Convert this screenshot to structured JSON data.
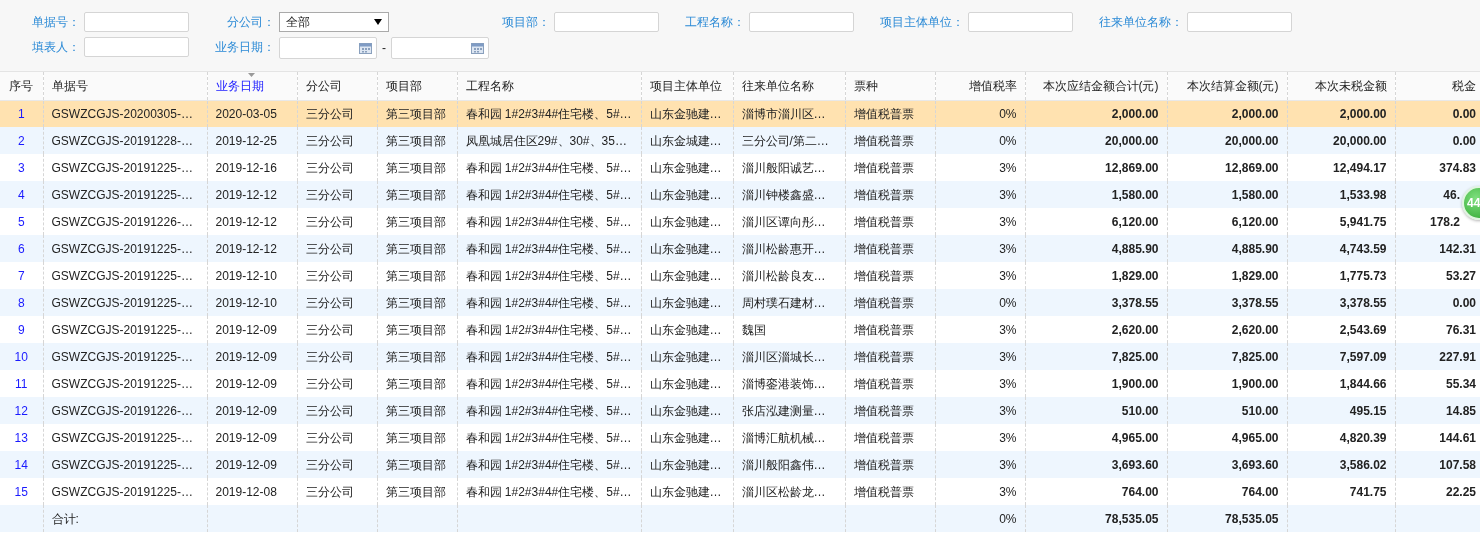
{
  "filters": [
    {
      "label": "单据号：",
      "kind": "text"
    },
    {
      "label": "分公司：",
      "kind": "select",
      "value": "全部"
    },
    {
      "label": "项目部：",
      "kind": "text"
    },
    {
      "label": "工程名称：",
      "kind": "text"
    },
    {
      "label": "项目主体单位：",
      "kind": "text"
    },
    {
      "label": "往来单位名称：",
      "kind": "text"
    },
    {
      "label": "填表人：",
      "kind": "text"
    },
    {
      "label": "业务日期：",
      "kind": "daterange",
      "separator": "-"
    }
  ],
  "table": {
    "columns": [
      {
        "label": "序号",
        "kind": "index",
        "sorted": false
      },
      {
        "label": "单据号",
        "kind": "text",
        "sorted": false
      },
      {
        "label": "业务日期",
        "kind": "text",
        "sorted": true
      },
      {
        "label": "分公司",
        "kind": "text",
        "sorted": false
      },
      {
        "label": "项目部",
        "kind": "text",
        "sorted": false
      },
      {
        "label": "工程名称",
        "kind": "text",
        "sorted": false
      },
      {
        "label": "项目主体单位",
        "kind": "text",
        "sorted": false
      },
      {
        "label": "往来单位名称",
        "kind": "text",
        "sorted": false
      },
      {
        "label": "票种",
        "kind": "text",
        "sorted": false
      },
      {
        "label": "增值税率",
        "kind": "rate",
        "sorted": false
      },
      {
        "label": "本次应结金额合计(元)",
        "kind": "amount",
        "sorted": false
      },
      {
        "label": "本次结算金额(元)",
        "kind": "amount",
        "sorted": false
      },
      {
        "label": "本次未税金额",
        "kind": "amount",
        "sorted": false
      },
      {
        "label": "税金",
        "kind": "amount",
        "sorted": false
      }
    ],
    "rows": [
      {
        "selected": true,
        "cells": [
          "1",
          "GSWZCGJS-20200305-…",
          "2020-03-05",
          "三分公司",
          "第三项目部",
          "春和园 1#2#3#4#住宅楼、5#…",
          "山东金驰建…",
          "淄博市淄川区…",
          "增值税普票",
          "0%",
          "2,000.00",
          "2,000.00",
          "2,000.00",
          "0.00"
        ]
      },
      {
        "selected": false,
        "cells": [
          "2",
          "GSWZCGJS-20191228-…",
          "2019-12-25",
          "三分公司",
          "第三项目部",
          "凤凰城居住区29#、30#、35…",
          "山东金城建…",
          "三分公司/第二…",
          "增值税普票",
          "0%",
          "20,000.00",
          "20,000.00",
          "20,000.00",
          "0.00"
        ]
      },
      {
        "selected": false,
        "cells": [
          "3",
          "GSWZCGJS-20191225-…",
          "2019-12-16",
          "三分公司",
          "第三项目部",
          "春和园 1#2#3#4#住宅楼、5#…",
          "山东金驰建…",
          "淄川般阳诚艺…",
          "增值税普票",
          "3%",
          "12,869.00",
          "12,869.00",
          "12,494.17",
          "374.83"
        ]
      },
      {
        "selected": false,
        "cells": [
          "4",
          "GSWZCGJS-20191225-…",
          "2019-12-12",
          "三分公司",
          "第三项目部",
          "春和园 1#2#3#4#住宅楼、5#…",
          "山东金驰建…",
          "淄川钟楼鑫盛…",
          "增值税普票",
          "3%",
          "1,580.00",
          "1,580.00",
          "1,533.98",
          "46."
        ],
        "partly_covered": true
      },
      {
        "selected": false,
        "cells": [
          "5",
          "GSWZCGJS-20191226-…",
          "2019-12-12",
          "三分公司",
          "第三项目部",
          "春和园 1#2#3#4#住宅楼、5#…",
          "山东金驰建…",
          "淄川区谭向彤…",
          "增值税普票",
          "3%",
          "6,120.00",
          "6,120.00",
          "5,941.75",
          "178.2"
        ],
        "partly_covered": true
      },
      {
        "selected": false,
        "cells": [
          "6",
          "GSWZCGJS-20191225-…",
          "2019-12-12",
          "三分公司",
          "第三项目部",
          "春和园 1#2#3#4#住宅楼、5#…",
          "山东金驰建…",
          "淄川松龄惠开…",
          "增值税普票",
          "3%",
          "4,885.90",
          "4,885.90",
          "4,743.59",
          "142.31"
        ]
      },
      {
        "selected": false,
        "cells": [
          "7",
          "GSWZCGJS-20191225-…",
          "2019-12-10",
          "三分公司",
          "第三项目部",
          "春和园 1#2#3#4#住宅楼、5#…",
          "山东金驰建…",
          "淄川松龄良友…",
          "增值税普票",
          "3%",
          "1,829.00",
          "1,829.00",
          "1,775.73",
          "53.27"
        ]
      },
      {
        "selected": false,
        "cells": [
          "8",
          "GSWZCGJS-20191225-…",
          "2019-12-10",
          "三分公司",
          "第三项目部",
          "春和园 1#2#3#4#住宅楼、5#…",
          "山东金驰建…",
          "周村璞石建材…",
          "增值税普票",
          "0%",
          "3,378.55",
          "3,378.55",
          "3,378.55",
          "0.00"
        ]
      },
      {
        "selected": false,
        "cells": [
          "9",
          "GSWZCGJS-20191225-…",
          "2019-12-09",
          "三分公司",
          "第三项目部",
          "春和园 1#2#3#4#住宅楼、5#…",
          "山东金驰建…",
          "魏国",
          "增值税普票",
          "3%",
          "2,620.00",
          "2,620.00",
          "2,543.69",
          "76.31"
        ]
      },
      {
        "selected": false,
        "cells": [
          "10",
          "GSWZCGJS-20191225-…",
          "2019-12-09",
          "三分公司",
          "第三项目部",
          "春和园 1#2#3#4#住宅楼、5#…",
          "山东金驰建…",
          "淄川区淄城长…",
          "增值税普票",
          "3%",
          "7,825.00",
          "7,825.00",
          "7,597.09",
          "227.91"
        ]
      },
      {
        "selected": false,
        "cells": [
          "11",
          "GSWZCGJS-20191225-…",
          "2019-12-09",
          "三分公司",
          "第三项目部",
          "春和园 1#2#3#4#住宅楼、5#…",
          "山东金驰建…",
          "淄博銮港装饰…",
          "增值税普票",
          "3%",
          "1,900.00",
          "1,900.00",
          "1,844.66",
          "55.34"
        ]
      },
      {
        "selected": false,
        "cells": [
          "12",
          "GSWZCGJS-20191226-…",
          "2019-12-09",
          "三分公司",
          "第三项目部",
          "春和园 1#2#3#4#住宅楼、5#…",
          "山东金驰建…",
          "张店泓建测量…",
          "增值税普票",
          "3%",
          "510.00",
          "510.00",
          "495.15",
          "14.85"
        ]
      },
      {
        "selected": false,
        "cells": [
          "13",
          "GSWZCGJS-20191225-…",
          "2019-12-09",
          "三分公司",
          "第三项目部",
          "春和园 1#2#3#4#住宅楼、5#…",
          "山东金驰建…",
          "淄博汇航机械…",
          "增值税普票",
          "3%",
          "4,965.00",
          "4,965.00",
          "4,820.39",
          "144.61"
        ]
      },
      {
        "selected": false,
        "cells": [
          "14",
          "GSWZCGJS-20191225-…",
          "2019-12-09",
          "三分公司",
          "第三项目部",
          "春和园 1#2#3#4#住宅楼、5#…",
          "山东金驰建…",
          "淄川般阳鑫伟…",
          "增值税普票",
          "3%",
          "3,693.60",
          "3,693.60",
          "3,586.02",
          "107.58"
        ]
      },
      {
        "selected": false,
        "cells": [
          "15",
          "GSWZCGJS-20191225-…",
          "2019-12-08",
          "三分公司",
          "第三项目部",
          "春和园 1#2#3#4#住宅楼、5#…",
          "山东金驰建…",
          "淄川区松龄龙…",
          "增值税普票",
          "3%",
          "764.00",
          "764.00",
          "741.75",
          "22.25"
        ]
      }
    ],
    "footer": {
      "label": "合计:",
      "vat_rate": "0%",
      "amount_total": "78,535.05",
      "settlement_amount": "78,535.05"
    }
  },
  "floating_badge": {
    "text": "44"
  }
}
